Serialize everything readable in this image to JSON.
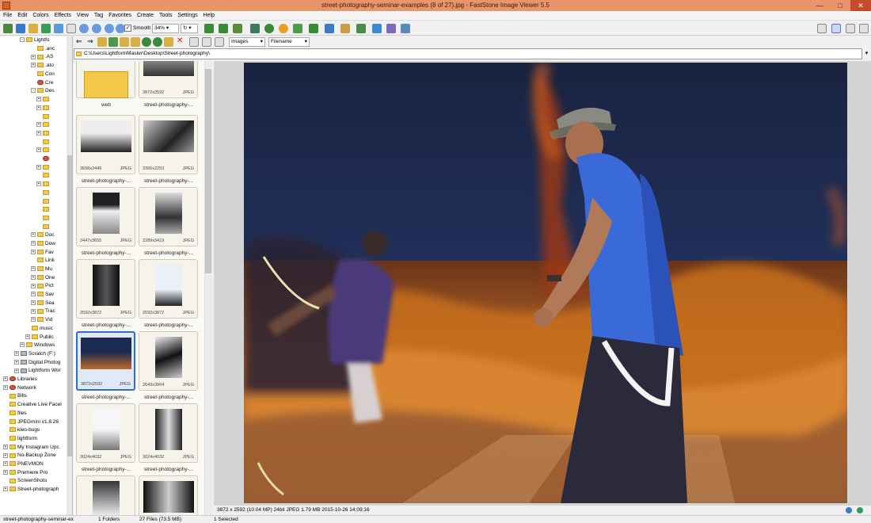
{
  "window": {
    "title": "street-photography-seminar-examples (8 of 27).jpg  -  FastStone Image Viewer 5.5"
  },
  "menu": [
    "File",
    "Edit",
    "Colors",
    "Effects",
    "View",
    "Tag",
    "Favorites",
    "Create",
    "Tools",
    "Settings",
    "Help"
  ],
  "toolbar": {
    "smooth_label": "Smooth",
    "zoom_value": "34%"
  },
  "browser": {
    "filter_value": "Images",
    "sort_value": "Filename",
    "path": "C:\\Users\\LightformMaster\\Desktop\\Street-photography\\"
  },
  "tree": {
    "items": [
      {
        "label": "Lightfo",
        "indent": 3,
        "kind": "folder",
        "exp": "-"
      },
      {
        "label": ".anc",
        "indent": 5,
        "kind": "folder",
        "exp": ""
      },
      {
        "label": ".AS",
        "indent": 5,
        "kind": "folder",
        "exp": "+"
      },
      {
        "label": ".ato",
        "indent": 5,
        "kind": "folder",
        "exp": "+"
      },
      {
        "label": "Con",
        "indent": 5,
        "kind": "folder",
        "exp": ""
      },
      {
        "label": "Cre",
        "indent": 5,
        "kind": "special",
        "exp": ""
      },
      {
        "label": "Des",
        "indent": 5,
        "kind": "folder",
        "exp": "-"
      },
      {
        "label": "",
        "indent": 6,
        "kind": "folder",
        "exp": "+"
      },
      {
        "label": "",
        "indent": 6,
        "kind": "folder",
        "exp": "+"
      },
      {
        "label": "",
        "indent": 6,
        "kind": "folder",
        "exp": ""
      },
      {
        "label": "",
        "indent": 6,
        "kind": "folder",
        "exp": "+"
      },
      {
        "label": "",
        "indent": 6,
        "kind": "folder",
        "exp": "+"
      },
      {
        "label": "",
        "indent": 6,
        "kind": "folder",
        "exp": ""
      },
      {
        "label": "",
        "indent": 6,
        "kind": "folder",
        "exp": "+"
      },
      {
        "label": "",
        "indent": 6,
        "kind": "special",
        "exp": ""
      },
      {
        "label": "",
        "indent": 6,
        "kind": "folder",
        "exp": "+"
      },
      {
        "label": "",
        "indent": 6,
        "kind": "folder",
        "exp": ""
      },
      {
        "label": "",
        "indent": 6,
        "kind": "folder",
        "exp": "+"
      },
      {
        "label": "",
        "indent": 6,
        "kind": "folder",
        "exp": ""
      },
      {
        "label": "",
        "indent": 6,
        "kind": "folder",
        "exp": ""
      },
      {
        "label": "",
        "indent": 6,
        "kind": "folder",
        "exp": ""
      },
      {
        "label": "",
        "indent": 6,
        "kind": "folder",
        "exp": ""
      },
      {
        "label": "",
        "indent": 6,
        "kind": "folder",
        "exp": ""
      },
      {
        "label": "Doc",
        "indent": 5,
        "kind": "folder",
        "exp": "+"
      },
      {
        "label": "Dow",
        "indent": 5,
        "kind": "folder",
        "exp": "+"
      },
      {
        "label": "Fav",
        "indent": 5,
        "kind": "folder",
        "exp": "+"
      },
      {
        "label": "Link",
        "indent": 5,
        "kind": "folder",
        "exp": ""
      },
      {
        "label": "Mu",
        "indent": 5,
        "kind": "folder",
        "exp": "+"
      },
      {
        "label": "One",
        "indent": 5,
        "kind": "folder",
        "exp": "+"
      },
      {
        "label": "Pict",
        "indent": 5,
        "kind": "folder",
        "exp": "+"
      },
      {
        "label": "Sav",
        "indent": 5,
        "kind": "folder",
        "exp": "+"
      },
      {
        "label": "Sea",
        "indent": 5,
        "kind": "folder",
        "exp": "+"
      },
      {
        "label": "Trac",
        "indent": 5,
        "kind": "folder",
        "exp": "+"
      },
      {
        "label": "Vid",
        "indent": 5,
        "kind": "folder",
        "exp": "+"
      },
      {
        "label": "music",
        "indent": 4,
        "kind": "folder",
        "exp": ""
      },
      {
        "label": "Public",
        "indent": 4,
        "kind": "folder",
        "exp": "+"
      },
      {
        "label": "Windows",
        "indent": 3,
        "kind": "folder",
        "exp": "+"
      },
      {
        "label": "Scratch (F:)",
        "indent": 2,
        "kind": "drive",
        "exp": "+"
      },
      {
        "label": "Digital Photog",
        "indent": 2,
        "kind": "drive",
        "exp": "+"
      },
      {
        "label": "Lightform Wor",
        "indent": 2,
        "kind": "drive",
        "exp": "+"
      },
      {
        "label": "Libraries",
        "indent": 0,
        "kind": "special",
        "exp": "+"
      },
      {
        "label": "Network",
        "indent": 0,
        "kind": "special",
        "exp": "+"
      },
      {
        "label": "Bills",
        "indent": 0,
        "kind": "folder",
        "exp": ""
      },
      {
        "label": "Creative Live Facel",
        "indent": 0,
        "kind": "folder",
        "exp": ""
      },
      {
        "label": "files",
        "indent": 0,
        "kind": "folder",
        "exp": ""
      },
      {
        "label": "JPEGmini v1.8.26",
        "indent": 0,
        "kind": "folder",
        "exp": ""
      },
      {
        "label": "kleo-bugs",
        "indent": 0,
        "kind": "folder",
        "exp": ""
      },
      {
        "label": "lightform",
        "indent": 0,
        "kind": "folder",
        "exp": ""
      },
      {
        "label": "My Instagram Upc",
        "indent": 0,
        "kind": "folder",
        "exp": "+"
      },
      {
        "label": "No-Backup Zone",
        "indent": 0,
        "kind": "folder",
        "exp": "+"
      },
      {
        "label": "PNEVMON",
        "indent": 0,
        "kind": "folder",
        "exp": "+"
      },
      {
        "label": "Premiere Pro",
        "indent": 0,
        "kind": "folder",
        "exp": "+"
      },
      {
        "label": "ScreenShots",
        "indent": 0,
        "kind": "folder",
        "exp": ""
      },
      {
        "label": "Street-photograph",
        "indent": 0,
        "kind": "folder",
        "exp": "+"
      }
    ]
  },
  "thumbnails": [
    {
      "name": "web",
      "dim": "",
      "fmt": "",
      "art": "folder"
    },
    {
      "name": "street-photography-...",
      "dim": "3872x2592",
      "fmt": "JPEG",
      "art": "land-dark"
    },
    {
      "name": "street-photography-...",
      "dim": "3658x2449",
      "fmt": "JPEG",
      "art": "land-bw"
    },
    {
      "name": "street-photography-...",
      "dim": "3365x2253",
      "fmt": "JPEG",
      "art": "land-bw2"
    },
    {
      "name": "street-photography-...",
      "dim": "2447x3655",
      "fmt": "JPEG",
      "art": "port-bw"
    },
    {
      "name": "street-photography-...",
      "dim": "2289x3419",
      "fmt": "JPEG",
      "art": "port-bw2"
    },
    {
      "name": "street-photography-...",
      "dim": "2592x3872",
      "fmt": "JPEG",
      "art": "port-dark"
    },
    {
      "name": "street-photography-...",
      "dim": "2592x3872",
      "fmt": "JPEG",
      "art": "port-sky"
    },
    {
      "name": "street-photography-...",
      "dim": "3872x2592",
      "fmt": "JPEG",
      "art": "land-color",
      "selected": true
    },
    {
      "name": "street-photography-...",
      "dim": "2643x3964",
      "fmt": "JPEG",
      "art": "port-bw3"
    },
    {
      "name": "street-photography-...",
      "dim": "3024x4032",
      "fmt": "JPEG",
      "art": "port-light"
    },
    {
      "name": "street-photography-...",
      "dim": "3024x4032",
      "fmt": "JPEG",
      "art": "port-bw4"
    },
    {
      "name": "",
      "dim": "",
      "fmt": "",
      "art": "port-bw5"
    },
    {
      "name": "",
      "dim": "",
      "fmt": "",
      "art": "land-bw3"
    }
  ],
  "image_info": "3872 x 2592 (10.04 MP)  24bit  JPEG    1.79 MB    2015-10-26 14:09:16",
  "status": {
    "file": "street-photography-seminar-ex",
    "folders": "1 Folders",
    "files": "27 Files (73.5 MB)",
    "selected": "1 Selected"
  },
  "colors": {
    "titlebar": "#e8956c",
    "selection": "#2a6fd6",
    "folder": "#f4c84a"
  }
}
